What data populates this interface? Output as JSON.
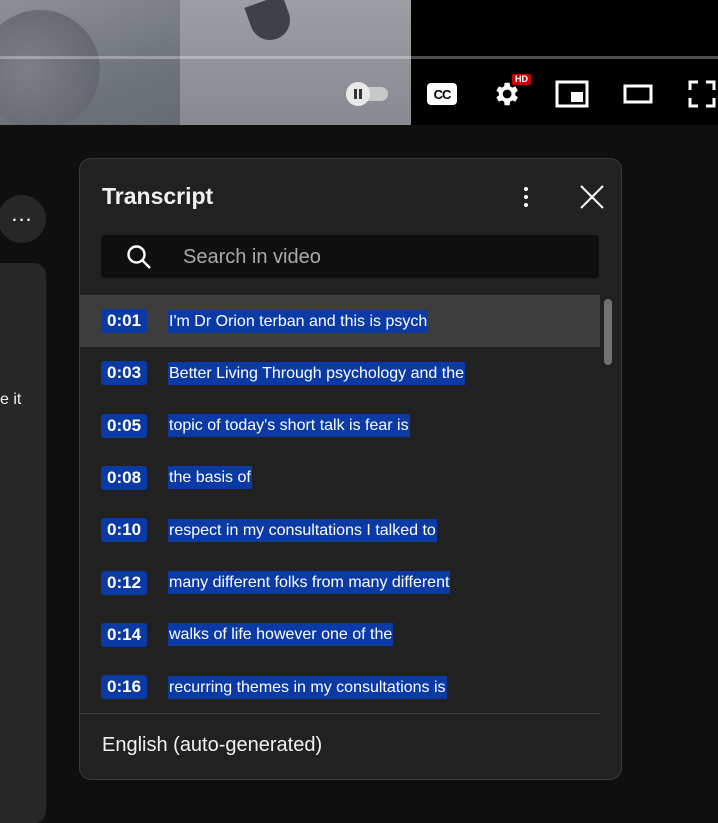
{
  "player": {
    "controls": {
      "autoplay_icon": "pause-toggle-icon",
      "cc_label": "CC",
      "hd_badge": "HD",
      "settings_icon": "gear-icon",
      "miniplayer_icon": "miniplayer-icon",
      "theater_icon": "theater-mode-icon",
      "fullscreen_icon": "fullscreen-icon"
    }
  },
  "left": {
    "more_label": "...",
    "partial_text": "e it"
  },
  "transcript": {
    "title": "Transcript",
    "menu_icon": "more-vert-icon",
    "close_icon": "close-icon",
    "search": {
      "placeholder": "Search in video",
      "value": ""
    },
    "segments": [
      {
        "time": "0:01",
        "text": "I'm Dr Orion terban and this is psych",
        "active": true
      },
      {
        "time": "0:03",
        "text": "Better Living Through psychology and the"
      },
      {
        "time": "0:05",
        "text": "topic of today's short talk is fear is"
      },
      {
        "time": "0:08",
        "text": "the basis of"
      },
      {
        "time": "0:10",
        "text": "respect in my consultations I talked to"
      },
      {
        "time": "0:12",
        "text": "many different folks from many different"
      },
      {
        "time": "0:14",
        "text": "walks of life however one of the"
      },
      {
        "time": "0:16",
        "text": "recurring themes in my consultations is"
      }
    ],
    "language": "English (auto-generated)"
  },
  "colors": {
    "highlight": "#0b3aa4",
    "panel_bg": "#212121",
    "active_row": "#3d3d3d"
  }
}
